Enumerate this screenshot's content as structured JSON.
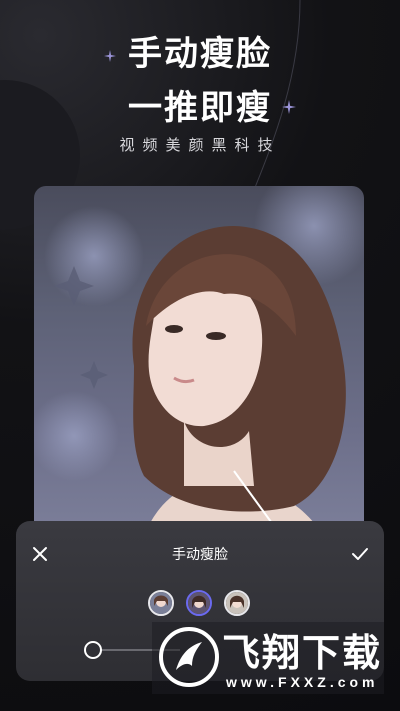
{
  "promo": {
    "headline_line1": "手动瘦脸",
    "headline_line2": "一推即瘦",
    "tagline": "视频美颜黑科技"
  },
  "editor_panel": {
    "title": "手动瘦脸",
    "close_icon": "close-icon",
    "confirm_icon": "check-icon",
    "face_thumbnails": [
      {
        "name": "face-1",
        "selected": false
      },
      {
        "name": "face-2",
        "selected": true
      },
      {
        "name": "face-3",
        "selected": false
      }
    ],
    "accent_color": "#6b6af0"
  },
  "watermark": {
    "title": "飞翔下载",
    "url": "www.FXXZ.com"
  }
}
